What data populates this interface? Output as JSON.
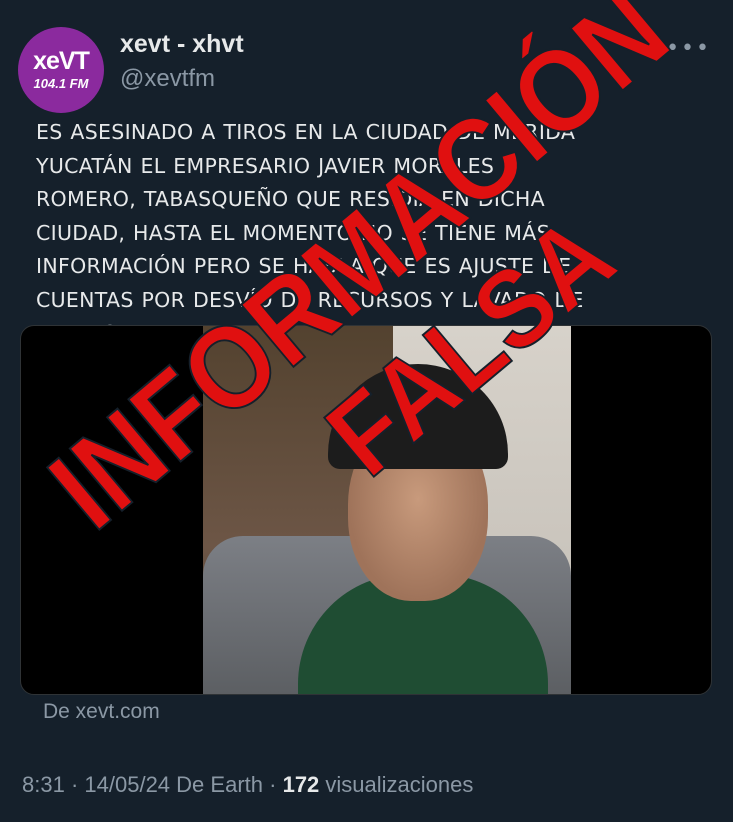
{
  "account": {
    "name": "xevt - xhvt",
    "handle": "@xevtfm",
    "avatar_logo_main": "xeVT",
    "avatar_logo_freq": "104.1 FM",
    "more_icon": "more-icon"
  },
  "post": {
    "text": "ES ASESINADO A TIROS EN LA CIUDAD DE MÉRIDA\nYUCATÁN EL EMPRESARIO JAVIER MORALES\nROMERO, TABASQUEÑO QUE RESIDÍA EN DICHA\nCIUDAD, HASTA EL MOMENTO NO SE TIENE MÁS\nINFORMACIÓN PERO SE HABLA QUE ES AJUSTE DE\nCUENTAS POR DESVÍO DE RECURSOS Y LAVADO DE\nDINERO",
    "media_caption": "De xevt.com",
    "time": "8:31",
    "date": "14/05/24",
    "source": "De Earth",
    "views_count": "172",
    "views_label": "visualizaciones",
    "sep": "·"
  },
  "overlay": {
    "line1": "INFORMACIÓN",
    "line2": "FALSA",
    "color": "#e01010"
  },
  "colors": {
    "background": "#15202b",
    "text": "#e7e9ea",
    "secondary": "#8b98a5",
    "avatar": "#8b2a9e"
  }
}
